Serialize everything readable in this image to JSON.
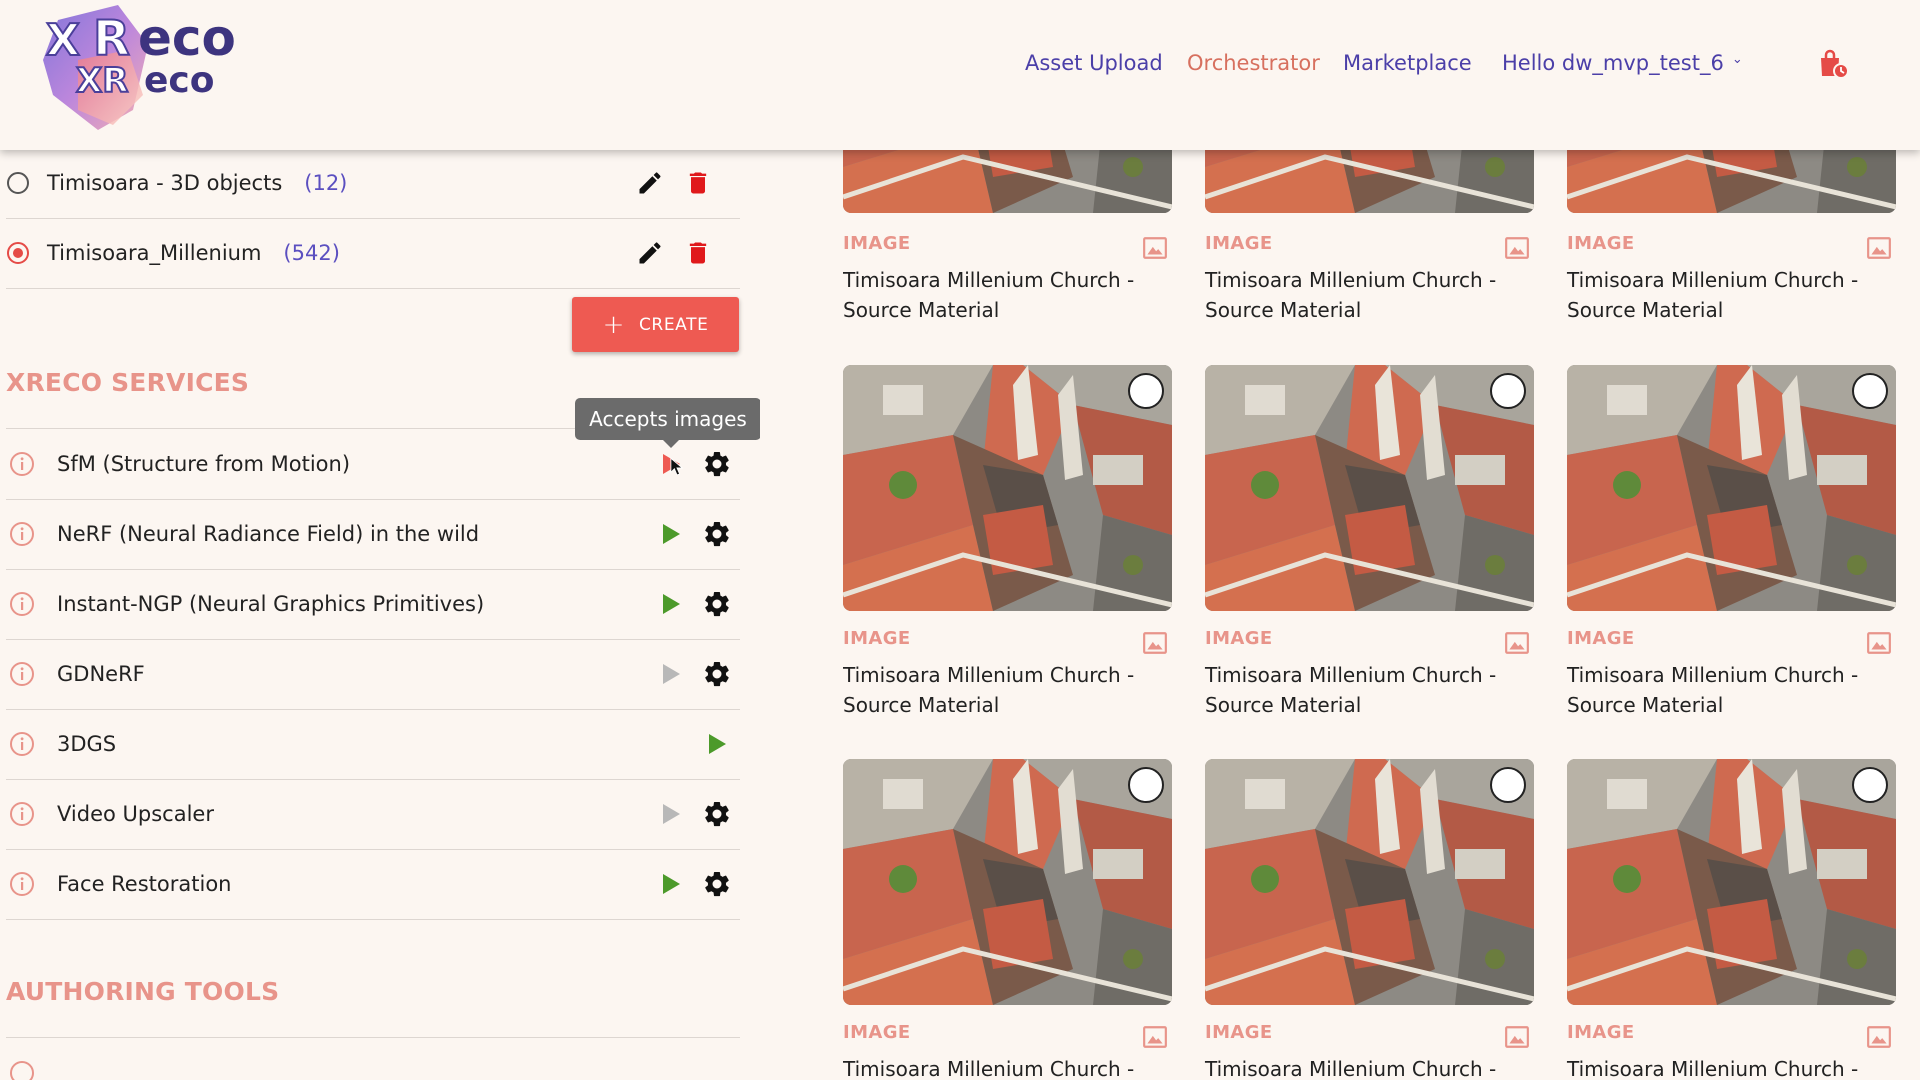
{
  "header": {
    "logo_text": "XReco",
    "nav": {
      "asset_upload": "Asset Upload",
      "orchestrator": "Orchestrator",
      "marketplace": "Marketplace",
      "user_greeting": "Hello dw_mvp_test_6"
    }
  },
  "collections": [
    {
      "name": "Timisoara - 3D objects",
      "count": "(12)",
      "selected": false
    },
    {
      "name": "Timisoara_Millenium",
      "count": "(542)",
      "selected": true
    }
  ],
  "create_label": "CREATE",
  "services": {
    "title": "XRECO SERVICES",
    "tooltip": "Accepts images",
    "items": [
      {
        "name": "SfM (Structure from Motion)",
        "play": "active-hover",
        "gear": true
      },
      {
        "name": "NeRF (Neural Radiance Field) in the wild",
        "play": "enabled",
        "gear": true
      },
      {
        "name": "Instant-NGP (Neural Graphics Primitives)",
        "play": "enabled",
        "gear": true
      },
      {
        "name": "GDNeRF",
        "play": "disabled",
        "gear": true
      },
      {
        "name": "3DGS",
        "play": "enabled",
        "gear": false
      },
      {
        "name": "Video Upscaler",
        "play": "disabled",
        "gear": true
      },
      {
        "name": "Face Restoration",
        "play": "enabled",
        "gear": true
      }
    ]
  },
  "authoring": {
    "title": "AUTHORING TOOLS"
  },
  "assets": {
    "type_label": "IMAGE",
    "title": "Timisoara Millenium Church - Source Material",
    "title_line1": "Timisoara Millenium Church -",
    "title_line2": "Source Material",
    "rows": 3,
    "cols": 3
  },
  "colors": {
    "background": "#fcf6f1",
    "accent_red": "#ee5a52",
    "section_pink": "#e8948a",
    "nav_purple": "#4b3fa8",
    "nav_orange": "#d7705f",
    "play_green": "#4c9a2a",
    "play_disabled": "#b8b8b8"
  }
}
